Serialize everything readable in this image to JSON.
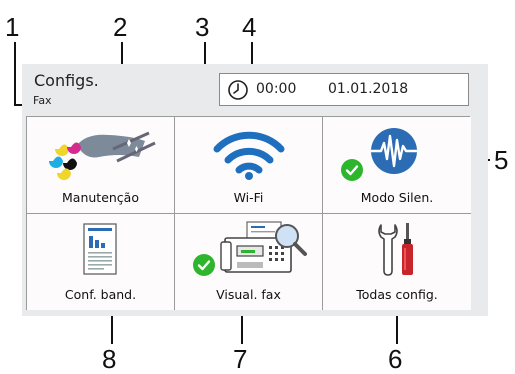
{
  "screen": {
    "title": "Configs.",
    "subtitle": "Fax",
    "time": "00:00",
    "date": "01.01.2018",
    "clock_icon": "clock-icon",
    "check_color": "#2eb52e",
    "wifi_color": "#1f6fbf"
  },
  "tiles": [
    {
      "label": "Manutenção",
      "icon": "ink-cartridge-icon"
    },
    {
      "label": "Wi-Fi",
      "icon": "wifi-icon"
    },
    {
      "label": "Modo Silen.",
      "icon": "quiet-mode-icon",
      "checked": true
    },
    {
      "label": "Conf. band.",
      "icon": "tray-settings-icon"
    },
    {
      "label": "Visual. fax",
      "icon": "fax-preview-icon",
      "checked": true
    },
    {
      "label": "Todas config.",
      "icon": "tools-icon"
    }
  ],
  "callouts": [
    "1",
    "2",
    "3",
    "4",
    "5",
    "6",
    "7",
    "8"
  ]
}
